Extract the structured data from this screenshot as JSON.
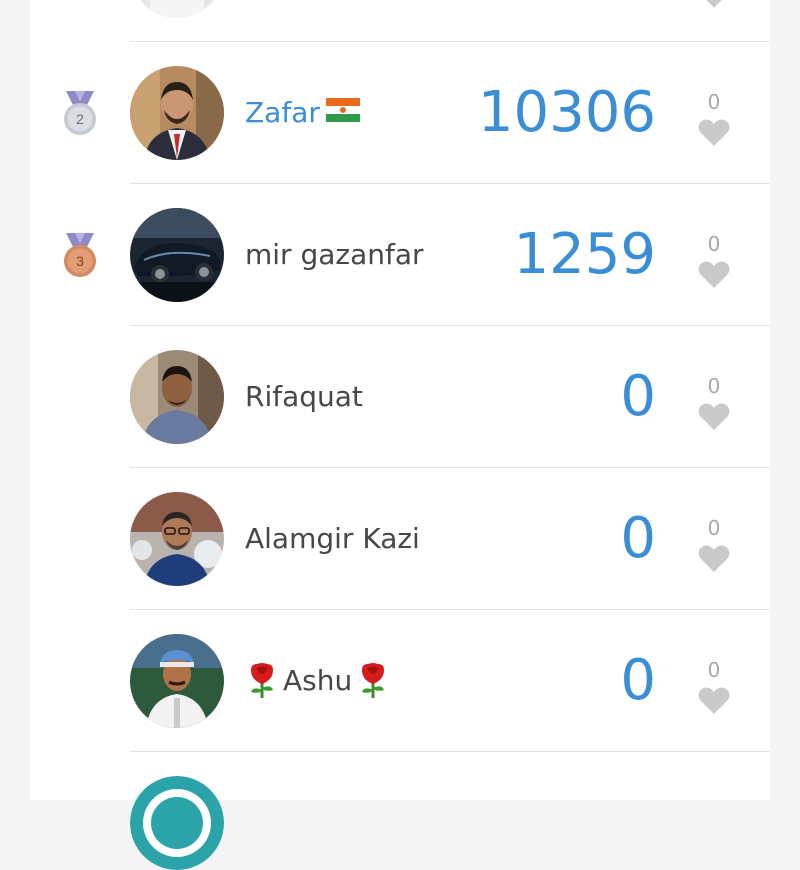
{
  "colors": {
    "accent_blue": "#3a8ed6",
    "text_dark": "#474747",
    "muted_gray": "#a8a8a8",
    "heart_gray": "#c9c9c9",
    "silver_medal": "#c5cad2",
    "bronze_medal": "#d4895f",
    "medal_ribbon": "#8f8ac6"
  },
  "leaderboard": {
    "rows": [
      {
        "rank_badge": "2",
        "name": "Zafar",
        "flag": "niger-flag",
        "score": "10306",
        "likes": "0"
      },
      {
        "rank_badge": "3",
        "name": "mir gazanfar",
        "score": "1259",
        "likes": "0"
      },
      {
        "name": "Rifaquat",
        "score": "0",
        "likes": "0"
      },
      {
        "name": "Alamgir Kazi",
        "score": "0",
        "likes": "0"
      },
      {
        "name": "Ashu",
        "decoration": "rose-emoji",
        "score": "0",
        "likes": "0"
      }
    ]
  }
}
